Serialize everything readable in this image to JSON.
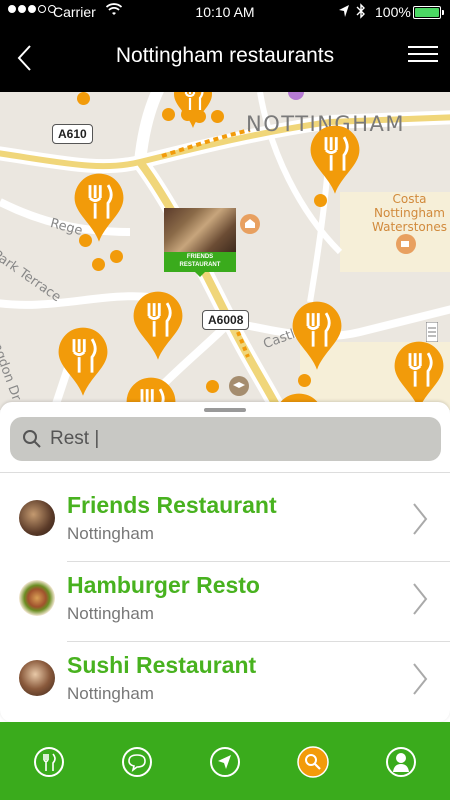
{
  "status_bar": {
    "carrier": "Carrier",
    "time": "10:10 AM",
    "battery_percent": "100%",
    "battery_level": 1.0
  },
  "header": {
    "title": "Nottingham restaurants",
    "back_icon": "chevron-left-icon",
    "menu_icon": "hamburger-menu-icon"
  },
  "map": {
    "city_label": "NOTTINGHAM",
    "place_label": "Costa\nNottingham\nWaterstones",
    "street_labels": [
      "Rege",
      "Park Terrace",
      "ngdon Dr",
      "Castl"
    ],
    "road_shields": [
      "A610",
      "A6008"
    ],
    "selected_marker_label": "FRIENDS\nRESTAURANT"
  },
  "search": {
    "value": "Rest |",
    "icon": "search-icon"
  },
  "results": [
    {
      "name": "Friends Restaurant",
      "city": "Nottingham"
    },
    {
      "name": "Hamburger Resto",
      "city": "Nottingham"
    },
    {
      "name": "Sushi Restaurant",
      "city": "Nottingham"
    }
  ],
  "tabbar": {
    "tabs": [
      {
        "icon": "restaurant-icon",
        "active": false
      },
      {
        "icon": "chat-icon",
        "active": false
      },
      {
        "icon": "navigation-icon",
        "active": false
      },
      {
        "icon": "search-icon",
        "active": true
      },
      {
        "icon": "profile-icon",
        "active": false
      }
    ]
  },
  "colors": {
    "brand_green": "#3aab1c",
    "accent_orange": "#f29b0a",
    "name_green": "#48b21f"
  }
}
